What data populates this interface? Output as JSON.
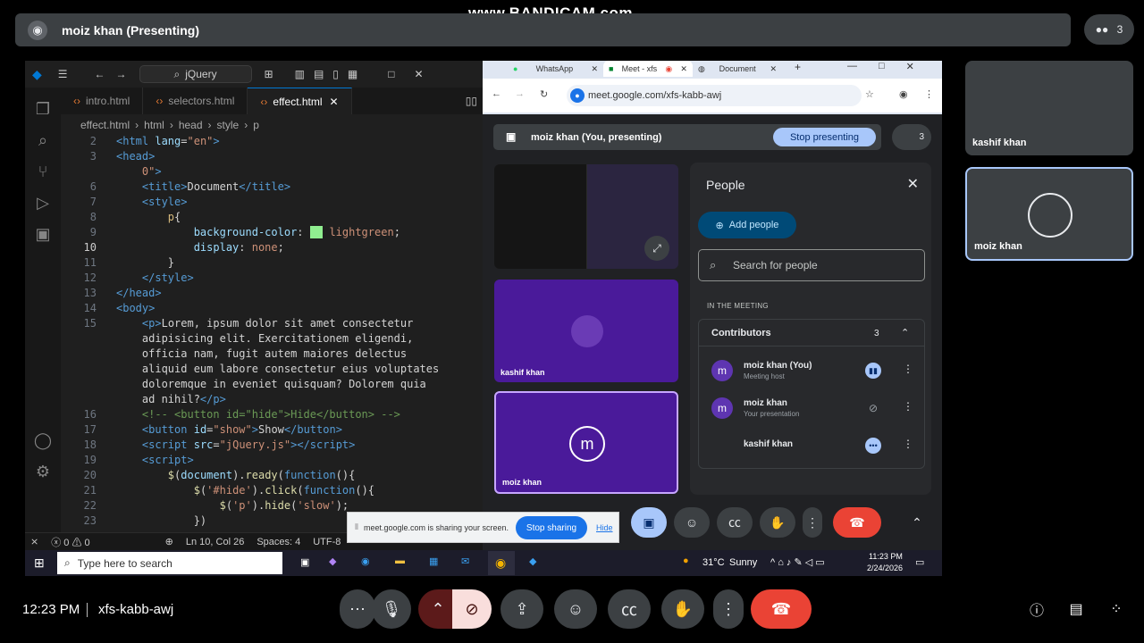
{
  "watermark": "www.BANDICAM.com",
  "topbar": {
    "title": "moiz khan (Presenting)",
    "people_count": "3"
  },
  "tiles": [
    {
      "name": "kashif khan"
    },
    {
      "name": "moiz khan"
    }
  ],
  "bottombar": {
    "time": "12:23 PM",
    "meeting_code": "xfs-kabb-awj"
  },
  "vscode": {
    "search": "jQuery",
    "tabs": [
      "intro.html",
      "selectors.html",
      "effect.html"
    ],
    "breadcrumb": [
      "effect.html",
      "html",
      "head",
      "style",
      "p"
    ],
    "status": {
      "errors": "0",
      "warnings": "0",
      "pos": "Ln 10, Col 26",
      "spaces": "Spaces: 4",
      "enc": "UTF-8"
    }
  },
  "taskbar": {
    "search": "Type here to search",
    "temp": "31°C",
    "weather": "Sunny",
    "clock": "11:23 PM",
    "date": "2/24/2026"
  },
  "chrome": {
    "tabs": [
      "WhatsApp",
      "Meet - xfs",
      "Document"
    ],
    "url": "meet.google.com/xfs-kabb-awj"
  },
  "inner_meet": {
    "presenting": "moiz khan (You, presenting)",
    "stop_presenting": "Stop presenting",
    "badge": "3",
    "tiles": [
      "kashif khan",
      "moiz khan"
    ],
    "tile_initial": "m"
  },
  "people": {
    "title": "People",
    "add": "Add people",
    "search_placeholder": "Search for people",
    "in_meeting": "IN THE MEETING",
    "contributors": "Contributors",
    "count": "3",
    "rows": [
      {
        "initial": "m",
        "name": "moiz khan (You)",
        "sub": "Meeting host"
      },
      {
        "initial": "m",
        "name": "moiz khan",
        "sub": "Your presentation"
      },
      {
        "initial": "",
        "name": "kashif khan",
        "sub": ""
      }
    ]
  },
  "share": {
    "text": "meet.google.com is sharing your screen.",
    "stop": "Stop sharing",
    "hide": "Hide"
  },
  "colors": {
    "hangup": "#ea4335",
    "accent": "#a8c7fa",
    "tile_purple": "#4a1a9a"
  }
}
